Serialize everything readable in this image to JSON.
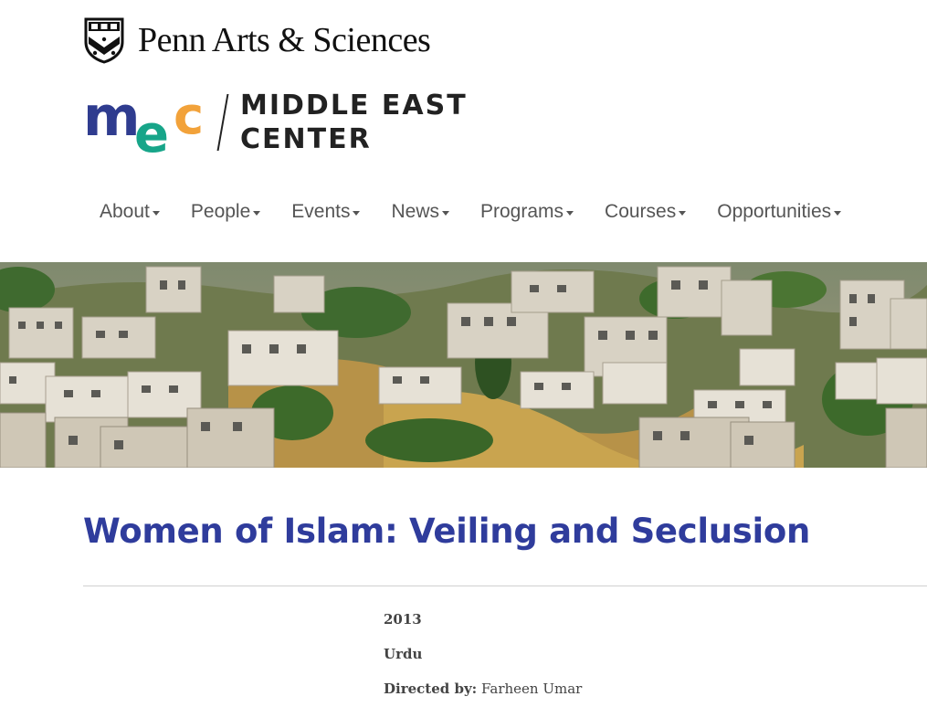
{
  "header": {
    "penn_label": "Penn Arts & Sciences",
    "logo_letters": [
      "m",
      "e",
      "c"
    ],
    "center_line1": "MIDDLE EAST",
    "center_line2": "CENTER",
    "brand_colors": {
      "navy": "#2f3c8f",
      "teal": "#17a589",
      "orange": "#f2a23a"
    }
  },
  "nav": {
    "items": [
      {
        "label": "About"
      },
      {
        "label": "People"
      },
      {
        "label": "Events"
      },
      {
        "label": "News"
      },
      {
        "label": "Programs"
      },
      {
        "label": "Courses"
      },
      {
        "label": "Opportunities"
      }
    ]
  },
  "page": {
    "title": "Women of Islam: Veiling and Seclusion",
    "year": "2013",
    "language": "Urdu",
    "directed_by_label": "Directed by:",
    "director": "Farheen Umar"
  }
}
